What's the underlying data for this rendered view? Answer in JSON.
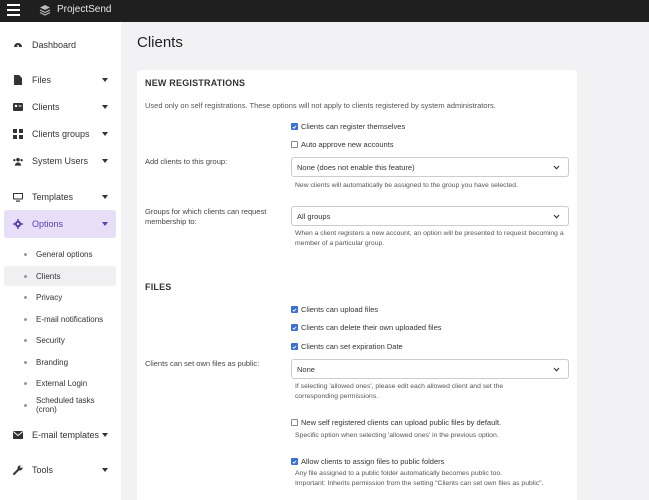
{
  "topbar": {
    "app_name": "ProjectSend"
  },
  "sidebar": {
    "items": [
      {
        "label": "Dashboard"
      },
      {
        "label": "Files"
      },
      {
        "label": "Clients"
      },
      {
        "label": "Clients groups"
      },
      {
        "label": "System Users"
      },
      {
        "label": "Templates"
      },
      {
        "label": "Options"
      },
      {
        "label": "E-mail templates"
      },
      {
        "label": "Tools"
      }
    ],
    "options_sub": [
      {
        "label": "General options"
      },
      {
        "label": "Clients"
      },
      {
        "label": "Privacy"
      },
      {
        "label": "E-mail notifications"
      },
      {
        "label": "Security"
      },
      {
        "label": "Branding"
      },
      {
        "label": "External Login"
      },
      {
        "label": "Scheduled tasks (cron)"
      }
    ]
  },
  "page": {
    "title": "Clients"
  },
  "registrations": {
    "title": "NEW REGISTRATIONS",
    "intro": "Used only on self registrations. These options will not apply to clients registered by system administrators.",
    "cb_register": "Clients can register themselves",
    "cb_register_checked": true,
    "cb_auto_approve": "Auto approve new accounts",
    "cb_auto_approve_checked": false,
    "group_label": "Add clients to this group:",
    "group_value": "None (does not enable this feature)",
    "group_help": "New clients will automatically be assigned to the group you have selected.",
    "request_label": "Groups for which clients can request membership to:",
    "request_value": "All groups",
    "request_help": "When a client registers a new account, an option will be presented to request becoming a member of a particular group."
  },
  "files": {
    "title": "FILES",
    "cb_upload": "Clients can upload files",
    "cb_delete": "Clients can delete their own uploaded files",
    "cb_expiration": "Clients can set expiration Date",
    "public_label": "Clients can set own files as public:",
    "public_value": "None",
    "public_help": "If selecting 'allowed ones', please edit each allowed client and set the corresponding permissions.",
    "cb_new_public": "New self registered clients can upload public files by default.",
    "cb_new_public_help": "Specific option when selecting 'allowed ones' in the previous option.",
    "cb_assign_public": "Allow clients to assign files to public folders",
    "assign_help_1": "Any file assigned to a public folder automatically becomes public too.",
    "assign_help_2": "Important: Inherits permission from the setting \"Clients can set own files as public\"."
  }
}
